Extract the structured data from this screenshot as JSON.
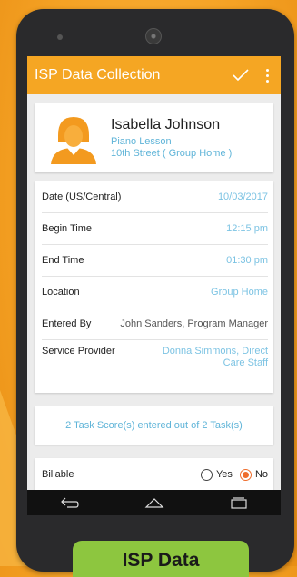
{
  "app": {
    "title": "ISP Data Collection"
  },
  "profile": {
    "name": "Isabella  Johnson",
    "service": "Piano Lesson",
    "location": "10th Street ( Group Home )"
  },
  "details": [
    {
      "label": "Date (US/Central)",
      "value": "10/03/2017"
    },
    {
      "label": "Begin Time",
      "value": "12:15 pm"
    },
    {
      "label": "End Time",
      "value": "01:30 pm"
    },
    {
      "label": "Location",
      "value": "Group Home"
    },
    {
      "label": "Entered By",
      "value": "John  Sanders, Program Manager"
    },
    {
      "label": "Service Provider",
      "value": "Donna Simmons, Direct Care Staff"
    }
  ],
  "score_summary": "2 Task Score(s) entered out of 2 Task(s)",
  "billable": {
    "label": "Billable",
    "options": [
      "Yes",
      "No"
    ],
    "selected": "No"
  },
  "cta_label": "ISP Data",
  "colors": {
    "accent": "#f5a623",
    "link": "#5fb4d8",
    "radio_on": "#ef6d2c",
    "cta": "#8dc63f"
  }
}
